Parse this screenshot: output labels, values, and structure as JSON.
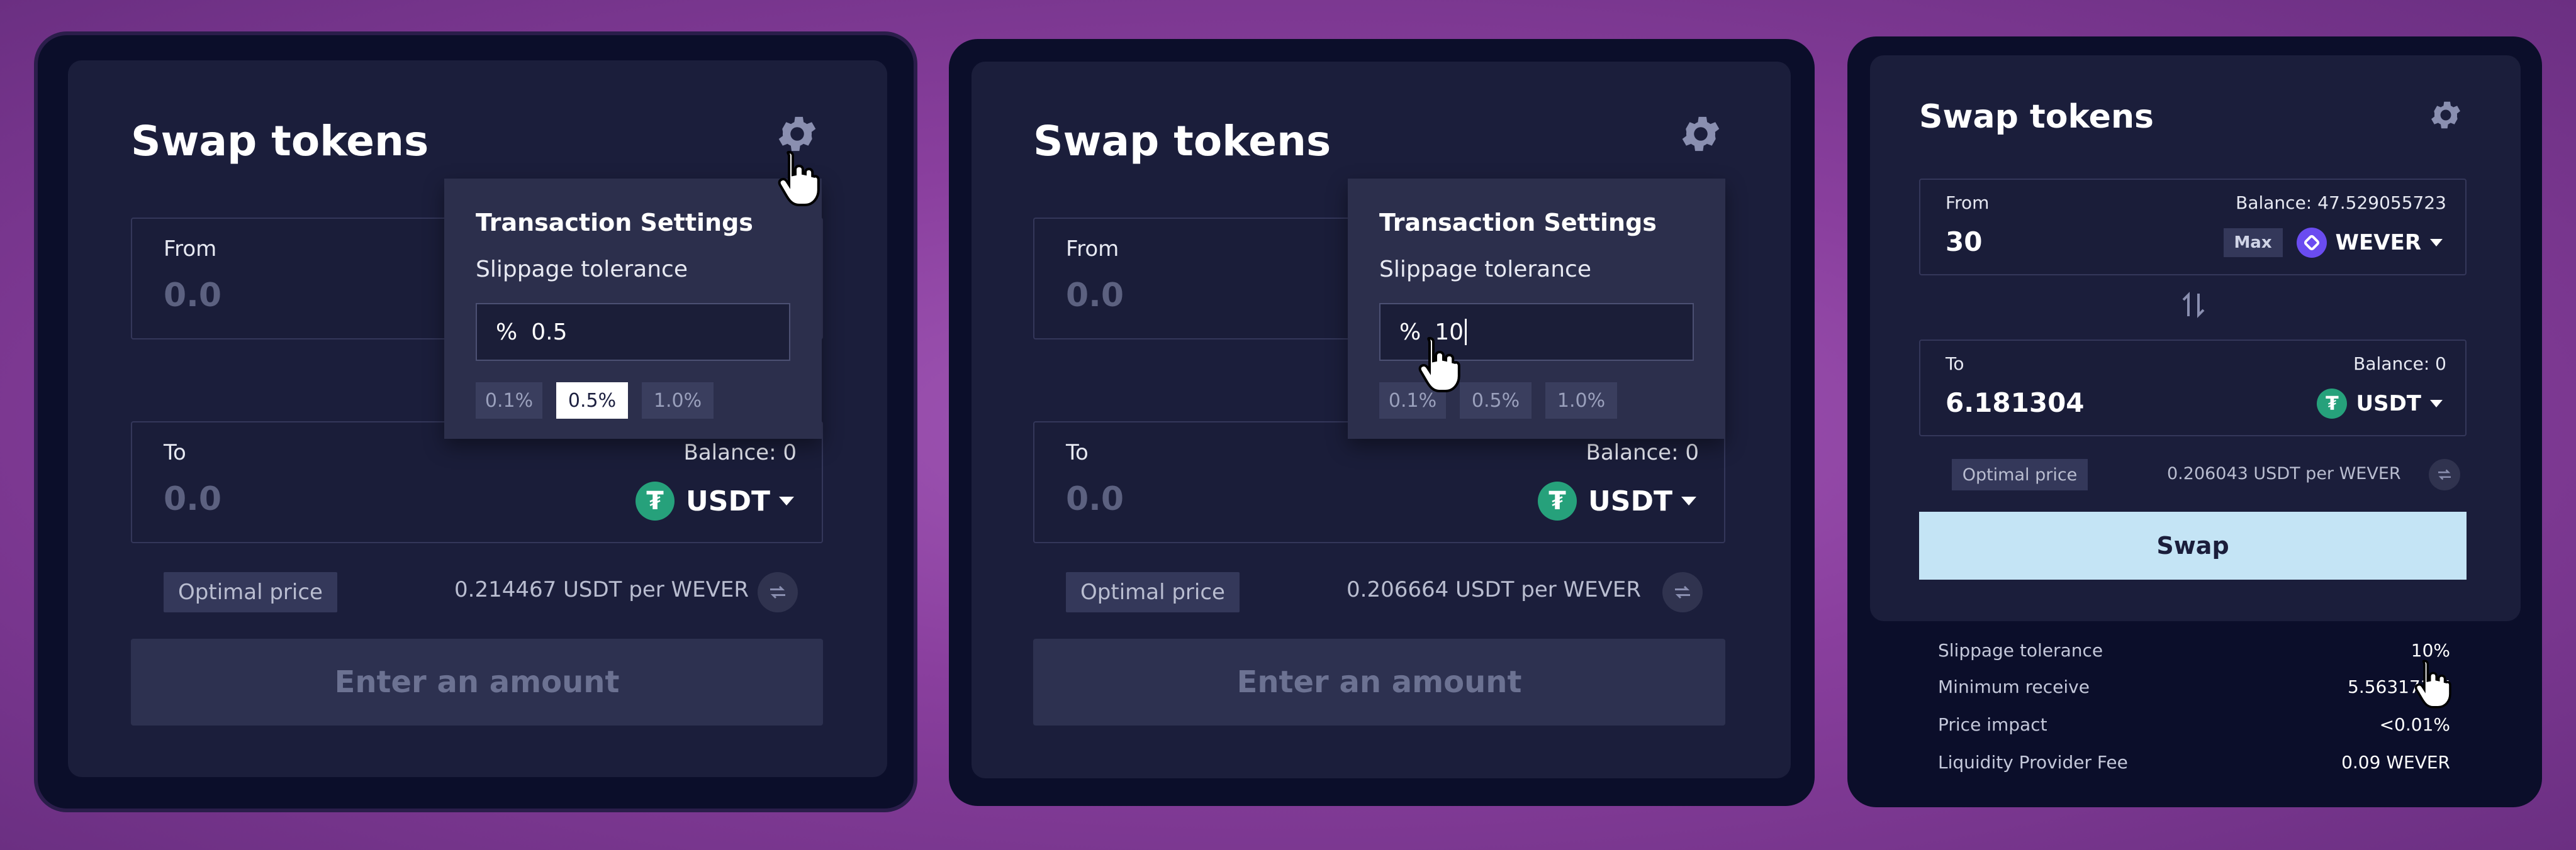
{
  "panels": [
    {
      "title": "Swap tokens",
      "from_label": "From",
      "from_value": "0.0",
      "to_label": "To",
      "to_value": "0.0",
      "to_balance": "Balance: 0",
      "to_token": "USDT",
      "optimal_price_label": "Optimal price",
      "price_text": "0.214467 USDT per WEVER",
      "action_button": "Enter an amount",
      "settings": {
        "title": "Transaction Settings",
        "slippage_label": "Slippage tolerance",
        "percent_symbol": "%",
        "slippage_value": "0.5",
        "options": [
          "0.1%",
          "0.5%",
          "1.0%"
        ],
        "active_option": "0.5%"
      }
    },
    {
      "title": "Swap tokens",
      "from_label": "From",
      "from_value": "0.0",
      "to_label": "To",
      "to_value": "0.0",
      "to_balance": "Balance: 0",
      "to_token": "USDT",
      "optimal_price_label": "Optimal price",
      "price_text": "0.206664 USDT per WEVER",
      "action_button": "Enter an amount",
      "settings": {
        "title": "Transaction Settings",
        "slippage_label": "Slippage tolerance",
        "percent_symbol": "%",
        "slippage_value": "10",
        "options": [
          "0.1%",
          "0.5%",
          "1.0%"
        ],
        "active_option": ""
      }
    },
    {
      "title": "Swap tokens",
      "from_label": "From",
      "from_balance": "Balance: 47.529055723",
      "from_value": "30",
      "max_label": "Max",
      "from_token": "WEVER",
      "to_label": "To",
      "to_balance": "Balance: 0",
      "to_value": "6.181304",
      "to_token": "USDT",
      "optimal_price_label": "Optimal price",
      "price_text": "0.206043 USDT per WEVER",
      "action_button": "Swap",
      "details": [
        {
          "label": "Slippage tolerance",
          "value": "10%"
        },
        {
          "label": "Minimum receive",
          "value": "5.563173 U"
        },
        {
          "label": "Price impact",
          "value": "<0.01%"
        },
        {
          "label": "Liquidity Provider Fee",
          "value": "0.09 WEVER"
        }
      ]
    }
  ],
  "colors": {
    "background": "#8a3f9e",
    "frame": "#0b0e2a",
    "card": "#1b1e3b",
    "swap_button": "#c4e4f5",
    "tether": "#26a17b",
    "wever": "#6a4cf0"
  }
}
